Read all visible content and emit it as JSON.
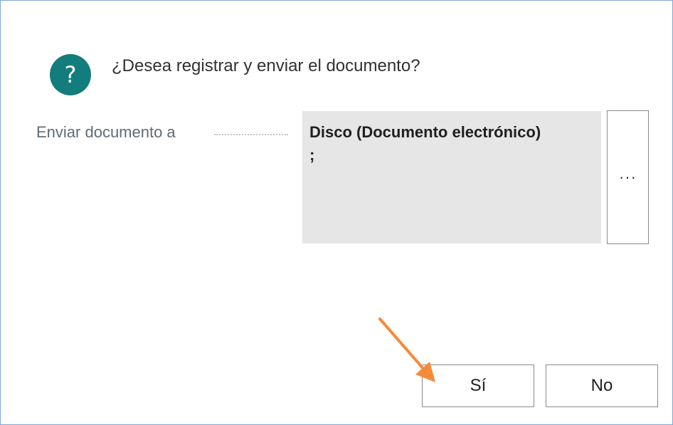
{
  "dialog": {
    "question": "¿Desea registrar y enviar el documento?",
    "question_icon": "question-mark-icon",
    "icon_color": "#137c7c"
  },
  "field": {
    "label": "Enviar documento a",
    "value_line1": "Disco (Documento electrónico)",
    "value_line2": ";",
    "more_label": "···"
  },
  "buttons": {
    "yes_label": "Sí",
    "no_label": "No"
  },
  "annotation": {
    "arrow_color": "#f58a3a"
  }
}
